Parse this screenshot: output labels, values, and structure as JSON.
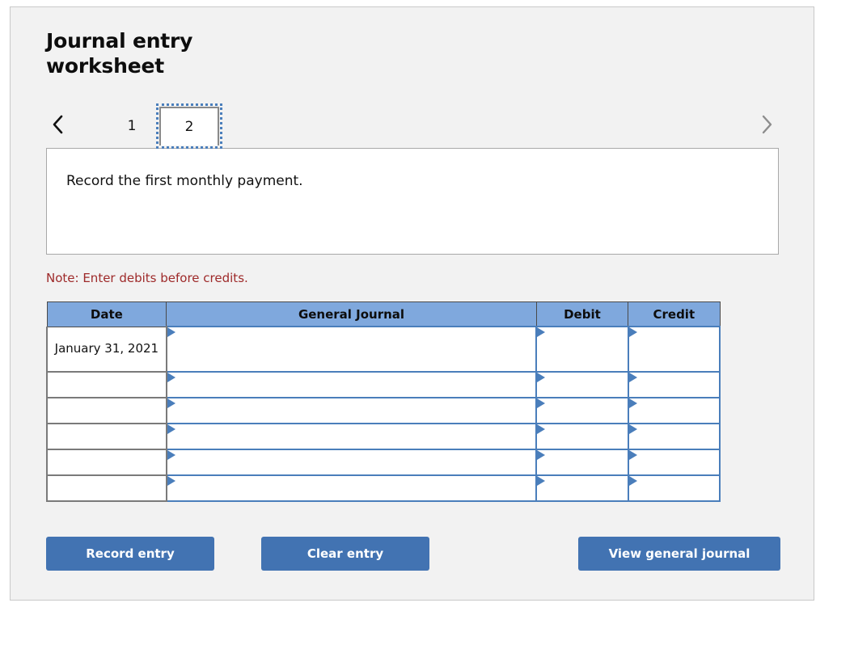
{
  "worksheet": {
    "title": "Journal entry worksheet",
    "instruction": "Record the first monthly payment.",
    "note": "Note: Enter debits before credits."
  },
  "tabs": {
    "prev_icon": "chevron-left-icon",
    "next_icon": "chevron-right-icon",
    "items": [
      {
        "label": "1",
        "active": false
      },
      {
        "label": "2",
        "active": true
      }
    ]
  },
  "table": {
    "headers": {
      "date": "Date",
      "general_journal": "General Journal",
      "debit": "Debit",
      "credit": "Credit"
    },
    "rows": [
      {
        "date": "January 31, 2021",
        "general_journal": "",
        "debit": "",
        "credit": ""
      },
      {
        "date": "",
        "general_journal": "",
        "debit": "",
        "credit": ""
      },
      {
        "date": "",
        "general_journal": "",
        "debit": "",
        "credit": ""
      },
      {
        "date": "",
        "general_journal": "",
        "debit": "",
        "credit": ""
      },
      {
        "date": "",
        "general_journal": "",
        "debit": "",
        "credit": ""
      },
      {
        "date": "",
        "general_journal": "",
        "debit": "",
        "credit": ""
      }
    ]
  },
  "buttons": {
    "record": "Record entry",
    "clear": "Clear entry",
    "view": "View general journal"
  },
  "colors": {
    "header_blue": "#7fa8dd",
    "button_blue": "#4273b2",
    "note_red": "#9e2a2a",
    "entry_border_blue": "#4a7ebb",
    "panel_bg": "#f2f2f2"
  }
}
